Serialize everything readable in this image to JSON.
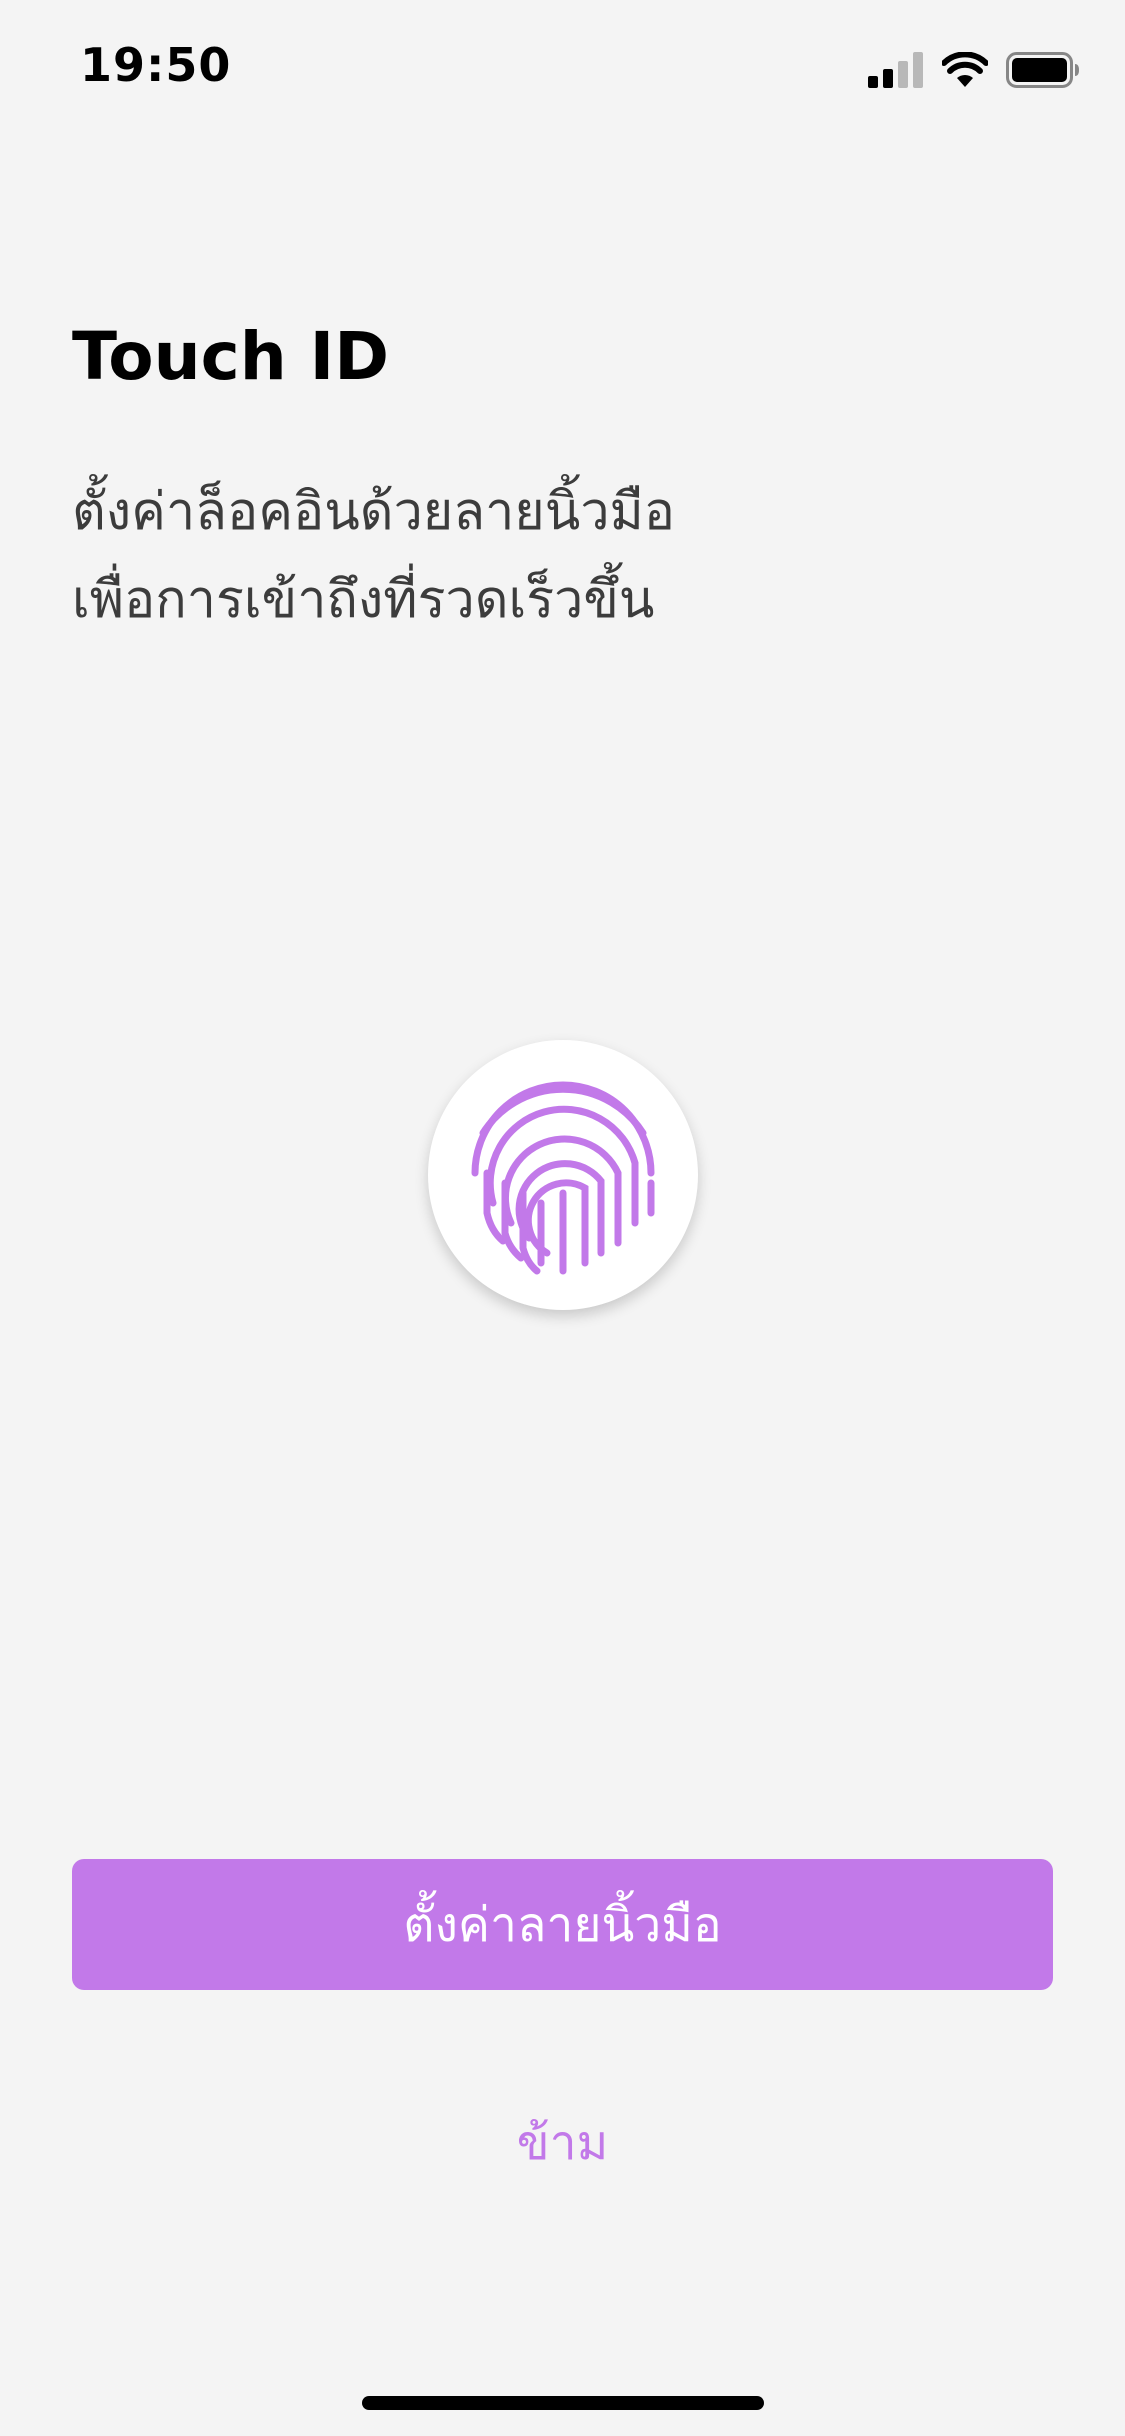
{
  "status_bar": {
    "time": "19:50",
    "signal_icon": "cellular-signal-icon",
    "wifi_icon": "wifi-icon",
    "battery_icon": "battery-icon"
  },
  "content": {
    "title": "Touch ID",
    "description": "ตั้งค่าล็อคอินด้วยลายนิ้วมือ เพื่อการเข้าถึงที่รวดเร็วขึ้น",
    "fingerprint_icon": "fingerprint-icon"
  },
  "actions": {
    "setup_label": "ตั้งค่าลายนิ้วมือ",
    "skip_label": "ข้าม"
  },
  "colors": {
    "accent": "#c279e9",
    "background": "#f4f4f4",
    "text_primary": "#000000",
    "text_secondary": "#3c3c3c"
  }
}
